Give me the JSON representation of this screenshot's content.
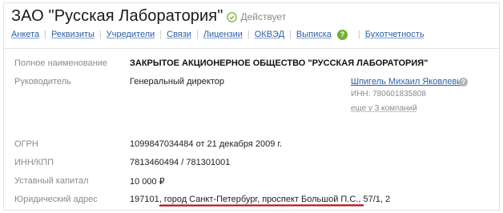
{
  "header": {
    "company_name": "ЗАО \"Русская Лаборатория\"",
    "status": "Действует",
    "status_color": "#6fb02e"
  },
  "tabs": [
    {
      "label": "Анкета"
    },
    {
      "label": "Реквизиты"
    },
    {
      "label": "Учредители"
    },
    {
      "label": "Связи"
    },
    {
      "label": "Лицензии"
    },
    {
      "label": "ОКВЭД"
    },
    {
      "label": "Выписка"
    },
    {
      "label": "Бухотчетность"
    }
  ],
  "help_badge": "?",
  "details": {
    "full_name_label": "Полное наименование",
    "full_name_value": "ЗАКРЫТОЕ АКЦИОНЕРНОЕ ОБЩЕСТВО \"РУССКАЯ ЛАБОРАТОРИЯ\"",
    "director_label": "Руководитель",
    "director_role": "Генеральный директор",
    "director_name": "Шпигель Михаил Яковлевич",
    "director_inn": "ИНН: 780601835808",
    "director_more": "еще у 3 компаний",
    "ogrn_label": "ОГРН",
    "ogrn_value": "1099847034484 от 21 декабря 2009 г.",
    "inn_kpp_label": "ИНН/КПП",
    "inn_kpp_value": "7813460494 / 781301001",
    "capital_label": "Уставный капитал",
    "capital_value": "10 000",
    "capital_currency": "₽",
    "address_label": "Юридический адрес",
    "address_value": "197101, город Санкт-Петербург, проспект Большой П.С., 57/1, 2"
  },
  "colors": {
    "link": "#2b5fa5",
    "label": "#8b8b8b",
    "highlight_underline": "#b40f17"
  }
}
